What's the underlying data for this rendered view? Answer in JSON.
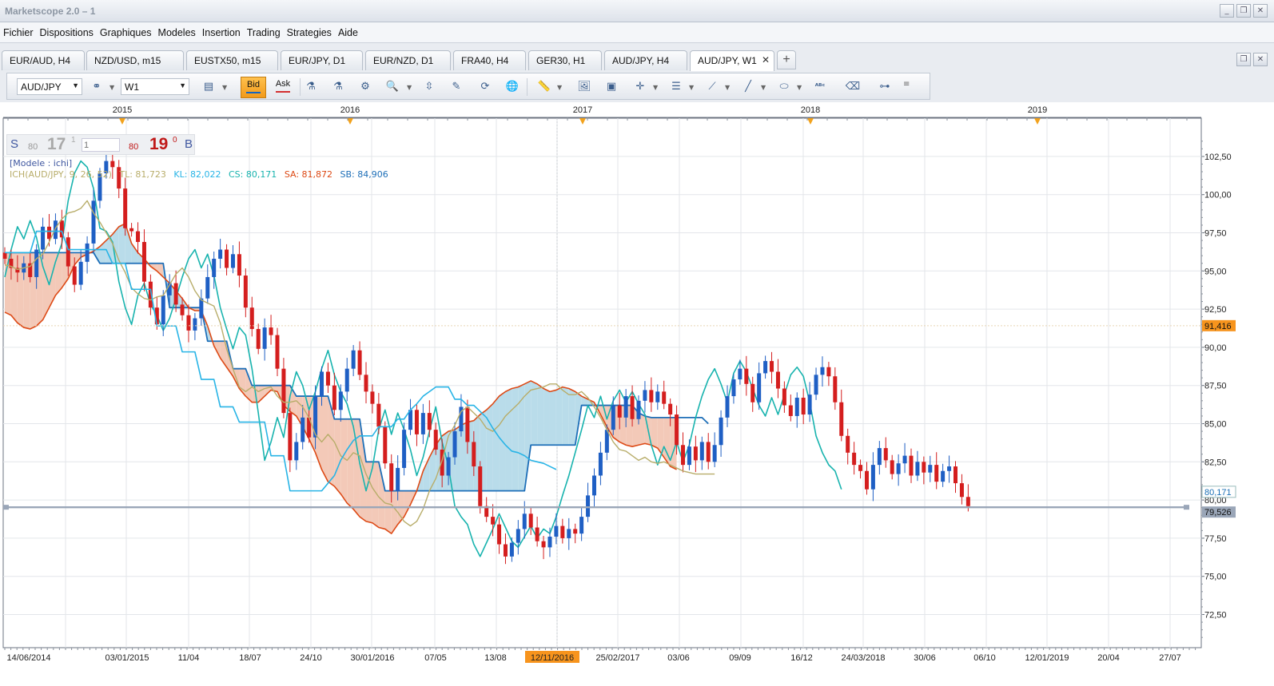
{
  "window": {
    "title": "Marketscope 2.0 – 1",
    "controls": [
      "_",
      "❐",
      "✕"
    ]
  },
  "menu": [
    "Fichier",
    "Dispositions",
    "Graphiques",
    "Modeles",
    "Insertion",
    "Trading",
    "Strategies",
    "Aide"
  ],
  "tabs": [
    {
      "label": "EUR/AUD, H4",
      "active": false
    },
    {
      "label": "NZD/USD, m15",
      "active": false
    },
    {
      "label": "EUSTX50, m15",
      "active": false
    },
    {
      "label": "EUR/JPY, D1",
      "active": false
    },
    {
      "label": "EUR/NZD, D1",
      "active": false
    },
    {
      "label": "FRA40, H4",
      "active": false
    },
    {
      "label": "GER30, H1",
      "active": false
    },
    {
      "label": "AUD/JPY, H4",
      "active": false
    },
    {
      "label": "AUD/JPY, W1",
      "active": true
    }
  ],
  "tab_close": "✕",
  "tab_add": "+",
  "toolbar": {
    "instrument": "AUD/JPY",
    "timeframe": "W1",
    "bid": "Bid",
    "ask": "Ask"
  },
  "quote": {
    "sell_label": "S",
    "sell_small": "80",
    "sell_big": "17",
    "sell_sup": "1",
    "amount_placeholder": "1",
    "buy_small": "80",
    "buy_big": "19",
    "buy_sup": "0",
    "buy_label": "B"
  },
  "model_label": "[Modele : ichi]",
  "indicator": {
    "name": "ICH(AUD/JPY, 9, 26, 52)",
    "tl": "TL: 81,723",
    "kl": "KL: 82,022",
    "cs": "CS: 80,171",
    "sa": "SA: 81,872",
    "sb": "SB: 84,906"
  },
  "colors": {
    "up": "#1f5fc4",
    "down": "#d41e1e",
    "tenkan": "#b8ad6a",
    "kijun": "#28b4e6",
    "chikou": "#18b3ae",
    "senkou_a": "#dd4a16",
    "senkou_b": "#1e6fb8",
    "cloud_bear": "#f3c9b8",
    "cloud_bull": "#b9dcea",
    "price_tag": "#f7941d",
    "level_tag": "#9aa6b8"
  },
  "chart_data": {
    "type": "candlestick",
    "instrument": "AUD/JPY",
    "timeframe": "W1",
    "y_ticks": [
      72.5,
      75,
      77.5,
      80,
      82.5,
      85,
      87.5,
      90,
      92.5,
      95,
      97.5,
      100,
      102.5
    ],
    "y_tick_labels": [
      "72,50",
      "75,00",
      "77,50",
      "80,00",
      "82,50",
      "85,00",
      "87,50",
      "90,00",
      "92,50",
      "95,00",
      "97,50",
      "100,00",
      "102,50"
    ],
    "ylim": [
      70.2,
      104.5
    ],
    "x_tick_labels": [
      "14/06/2014",
      "03/01/2015",
      "11/04",
      "18/07",
      "24/10",
      "30/01/2016",
      "07/05",
      "13/08",
      "12/11/2016",
      "25/02/2017",
      "03/06",
      "09/09",
      "16/12",
      "24/03/2018",
      "30/06",
      "06/10",
      "12/01/2019",
      "20/04",
      "27/07"
    ],
    "highlighted_x_label": "12/11/2016",
    "top_year_labels": [
      "2015",
      "2016",
      "2017",
      "2018",
      "2019"
    ],
    "price_markers": [
      {
        "label": "91,416",
        "value": 91.416,
        "kind": "current"
      },
      {
        "label": "80,171",
        "value": 80.171,
        "kind": "cs"
      },
      {
        "label": "79,526",
        "value": 79.526,
        "kind": "line"
      }
    ],
    "horizontal_line": 79.526,
    "close": [
      95.8,
      95.2,
      94.9,
      95.5,
      94.6,
      96.4,
      97.9,
      97.1,
      98.3,
      97.2,
      95.3,
      94.1,
      95.6,
      96.8,
      99.6,
      101.4,
      102.2,
      101.8,
      100.4,
      97.8,
      97.6,
      96.9,
      94.3,
      92.6,
      91.5,
      93.4,
      94.2,
      92.8,
      92.1,
      91.1,
      91.9,
      93.2,
      94.6,
      95.8,
      96.4,
      95.2,
      96.1,
      94.7,
      92.6,
      91.2,
      89.9,
      91.3,
      90.8,
      88.6,
      85.7,
      82.6,
      83.8,
      85.4,
      84.1,
      86.8,
      88.4,
      87.5,
      85.9,
      87.1,
      88.6,
      89.8,
      88.2,
      87.1,
      86.3,
      84.8,
      82.4,
      80.6,
      82.1,
      84.6,
      85.9,
      84.3,
      85.7,
      84.6,
      83.3,
      81.6,
      82.8,
      84.5,
      86.1,
      83.8,
      82.2,
      79.6,
      78.9,
      78.4,
      77.1,
      76.3,
      77.2,
      78.1,
      79.1,
      78.2,
      77.3,
      76.9,
      77.6,
      78.3,
      77.5,
      78.1,
      77.8,
      78.9,
      80.3,
      81.6,
      83.1,
      84.6,
      86.2,
      85.4,
      86.8,
      85.3,
      86.5,
      87.2,
      86.4,
      87.1,
      86.3,
      85.6,
      83.6,
      82.3,
      83.5,
      82.6,
      83.8,
      82.5,
      83.6,
      85.4,
      86.8,
      87.9,
      88.6,
      87.6,
      86.4,
      88.3,
      89.1,
      88.4,
      87.3,
      86.2,
      85.5,
      86.7,
      85.6,
      86.9,
      88.2,
      88.7,
      88.1,
      86.4,
      84.2,
      83.1,
      82.3,
      81.9,
      80.7,
      82.3,
      83.4,
      82.6,
      81.7,
      82.4,
      82.9,
      81.6,
      82.5,
      81.8,
      82.3,
      81.2,
      81.9,
      82.2,
      81.1,
      80.2,
      79.6
    ],
    "tenkan": [
      95.4,
      95.3,
      95.1,
      95.2,
      95.3,
      95.8,
      96.1,
      96.9,
      97.8,
      98.4,
      98.8,
      98.9,
      99.1,
      99.6,
      98.8,
      98.2,
      97.5,
      96.8,
      95.7,
      94.9,
      93.9,
      93.5,
      93.2,
      93.1,
      93.3,
      93.4,
      94.1,
      94.8,
      95.2,
      94.6,
      93.7,
      93.1,
      92.9,
      92.7,
      91.6,
      89.9,
      88.6,
      87.4,
      87.1,
      87.4,
      87.1,
      87.3,
      87.4,
      86.8,
      86.4,
      86.4,
      86.5,
      86.1,
      85.4,
      84.3,
      83.8,
      84.3,
      83.8,
      82.9,
      82.6,
      83.1,
      82.9,
      81.7,
      80.8,
      80.2,
      79.8,
      79.7,
      79.2,
      78.6,
      78.3,
      78.6,
      79.4,
      80.6,
      81.4,
      82.6,
      84.2,
      84.9,
      85.8,
      86.1,
      85.7,
      85.3,
      84.7,
      84.5,
      84.9,
      85.5,
      85.9,
      86.3,
      86.8,
      87.2,
      87.3,
      87.4,
      87.6,
      87.6,
      87.2,
      86.9,
      86.9,
      87.1,
      86.7,
      86.1,
      85.4,
      84.6,
      83.8,
      83.3,
      83.2,
      82.9,
      82.6,
      82.8,
      82.5,
      82.4,
      82.5,
      82.3,
      82.1,
      81.9,
      81.8,
      81.7,
      81.7,
      81.7,
      81.7
    ],
    "kijun": [
      96.2,
      96.2,
      96.2,
      96.2,
      96.2,
      97.6,
      97.6,
      97.6,
      97.6,
      97.6,
      96.4,
      96.4,
      96.4,
      96.4,
      96.4,
      96.4,
      96.4,
      95.5,
      95.5,
      95.5,
      93.8,
      93.8,
      93.8,
      93.8,
      91.4,
      91.4,
      91.4,
      91.4,
      89.7,
      89.7,
      89.7,
      87.9,
      87.9,
      87.9,
      86.1,
      86.1,
      86.1,
      85.1,
      85.1,
      85.1,
      85.1,
      85.1,
      82.9,
      82.9,
      82.9,
      80.6,
      80.6,
      80.6,
      80.6,
      80.6,
      80.6,
      81.1,
      81.6,
      82.6,
      83.3,
      83.9,
      84.2,
      84.2,
      84.2,
      84.8,
      84.8,
      84.8,
      85.3,
      85.3,
      85.9,
      86.3,
      86.8,
      87.1,
      87.4,
      87.4,
      87.4,
      86.6,
      86.6,
      86.2,
      86.2,
      85.8,
      85.4,
      84.7,
      84.1,
      83.6,
      83.2,
      83.1,
      82.9,
      82.6,
      82.5,
      82.4,
      82.2,
      82.0
    ],
    "chikou": [
      94.6,
      96.4,
      97.9,
      97.1,
      98.3,
      97.2,
      95.3,
      94.1,
      95.6,
      96.8,
      99.6,
      101.4,
      102.2,
      101.8,
      100.4,
      97.8,
      97.6,
      96.9,
      94.3,
      92.6,
      91.5,
      93.4,
      94.2,
      92.8,
      92.1,
      91.1,
      91.9,
      93.2,
      94.6,
      95.8,
      96.4,
      95.2,
      96.1,
      94.7,
      92.6,
      91.2,
      89.9,
      91.3,
      90.8,
      88.6,
      85.7,
      82.6,
      83.8,
      85.4,
      84.1,
      86.8,
      88.4,
      87.5,
      85.9,
      87.1,
      88.6,
      89.8,
      88.2,
      87.1,
      86.3,
      84.8,
      82.4,
      80.6,
      82.1,
      84.6,
      85.9,
      84.3,
      85.7,
      84.6,
      83.3,
      81.6,
      82.8,
      84.5,
      86.1,
      83.8,
      82.2,
      79.6,
      78.9,
      78.4,
      77.1,
      76.3,
      77.2,
      78.1,
      79.1,
      78.2,
      77.3,
      76.9,
      77.6,
      78.3,
      77.5,
      78.1,
      77.8,
      78.9,
      80.3,
      81.6,
      83.1,
      84.6,
      86.2,
      85.4,
      86.8,
      85.3,
      86.5,
      87.2,
      86.4,
      87.1,
      86.3,
      85.6,
      83.6,
      82.3,
      83.5,
      82.6,
      83.8,
      82.5,
      83.6,
      85.4,
      86.8,
      87.9,
      88.6,
      87.6,
      86.4,
      88.3,
      89.1,
      88.4,
      87.3,
      86.2,
      85.5,
      86.7,
      85.6,
      86.9,
      88.2,
      88.7,
      88.1,
      86.4,
      84.2,
      83.1,
      82.3,
      81.9,
      80.7
    ],
    "senkou_a": [
      92.3,
      92.1,
      91.6,
      91.3,
      91.2,
      91.4,
      91.8,
      92.6,
      93.4,
      93.9,
      94.5,
      95.4,
      95.9,
      96.1,
      96.3,
      96.6,
      97.0,
      97.4,
      97.9,
      98.1,
      96.8,
      96.2,
      95.8,
      95.3,
      95.0,
      94.6,
      94.2,
      93.7,
      93.2,
      92.6,
      92.4,
      92.4,
      91.4,
      90.1,
      89.3,
      88.7,
      88.1,
      87.3,
      86.8,
      86.4,
      86.4,
      86.8,
      87.2,
      87.1,
      86.2,
      85.8,
      85.5,
      84.8,
      84.0,
      83.1,
      82.0,
      81.2,
      80.9,
      80.4,
      79.8,
      79.4,
      78.9,
      78.6,
      78.5,
      78.2,
      78.1,
      77.8,
      78.4,
      78.9,
      79.7,
      80.6,
      81.9,
      82.8,
      83.6,
      84.2,
      84.5,
      84.6,
      84.9,
      85.1,
      85.2,
      85.6,
      85.9,
      86.3,
      86.8,
      87.1,
      87.3,
      87.4,
      87.6,
      87.8,
      87.6,
      87.3,
      87.1,
      87.2,
      87.4,
      87.3,
      87.1,
      86.8,
      86.6,
      86.4,
      85.6,
      84.8,
      84.1,
      83.8,
      83.6,
      83.5,
      83.6,
      83.7,
      83.6,
      83.4,
      82.8,
      82.2,
      82.0
    ],
    "senkou_b": [
      96.2,
      96.2,
      96.2,
      96.2,
      96.2,
      96.2,
      96.2,
      96.2,
      96.2,
      96.2,
      96.2,
      96.2,
      96.2,
      96.2,
      96.2,
      95.5,
      95.5,
      95.5,
      95.5,
      95.5,
      95.5,
      95.5,
      95.5,
      95.5,
      95.5,
      95.5,
      92.6,
      92.6,
      92.6,
      92.6,
      92.6,
      92.6,
      90.4,
      90.4,
      90.4,
      90.4,
      88.6,
      88.6,
      88.6,
      87.5,
      87.5,
      87.5,
      87.5,
      87.5,
      87.5,
      87.5,
      86.8,
      86.8,
      86.8,
      86.8,
      86.8,
      86.8,
      85.3,
      85.3,
      85.3,
      85.3,
      85.3,
      82.5,
      82.5,
      82.5,
      80.6,
      80.6,
      80.6,
      80.6,
      80.6,
      80.6,
      80.6,
      80.6,
      80.6,
      80.6,
      80.6,
      80.6,
      80.6,
      80.6,
      80.6,
      80.6,
      80.6,
      80.6,
      80.6,
      80.6,
      80.6,
      80.6,
      80.6,
      83.6,
      83.6,
      83.6,
      83.6,
      83.6,
      83.6,
      83.6,
      83.6,
      86.2,
      86.2,
      86.2,
      86.2,
      86.2,
      86.2,
      86.2,
      86.2,
      86.2,
      85.7,
      85.5,
      85.4,
      85.4,
      85.4,
      85.4,
      85.4,
      85.4,
      85.4,
      85.4,
      85.4,
      85.0
    ]
  }
}
